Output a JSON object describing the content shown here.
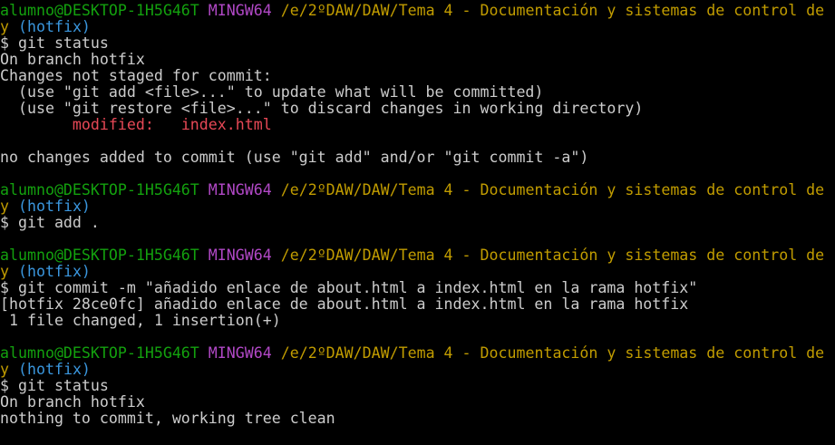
{
  "window": {
    "user_host": "alumno@DESKTOP-1H5G46T",
    "system": "MINGW64",
    "path_line1": "/e/2ºDAW/DAW/Tema 4 - Documentación y sistemas de control de",
    "path_line2": "y",
    "branch": "(hotfix)"
  },
  "blocks": [
    {
      "command": "$ git status",
      "output": [
        "On branch hotfix",
        "Changes not staged for commit:",
        "  (use \"git add <file>...\" to update what will be committed)",
        "  (use \"git restore <file>...\" to discard changes in working directory)"
      ],
      "modified_label": "        modified:   ",
      "modified_file": "index.html",
      "output_after": "no changes added to commit (use \"git add\" and/or \"git commit -a\")"
    },
    {
      "command": "$ git add ."
    },
    {
      "command": "$ git commit -m \"añadido enlace de about.html a index.html en la rama hotfix\"",
      "output": [
        "[hotfix 28ce0fc] añadido enlace de about.html a index.html en la rama hotfix",
        " 1 file changed, 1 insertion(+)"
      ]
    },
    {
      "command": "$ git status",
      "output": [
        "On branch hotfix",
        "nothing to commit, working tree clean"
      ]
    }
  ],
  "colors": {
    "background": "#000000",
    "text": "#cccccc",
    "user_host": "#13a10e",
    "system": "#b148c6",
    "path": "#c19c00",
    "branch": "#3a96dd",
    "modified": "#e74856"
  }
}
